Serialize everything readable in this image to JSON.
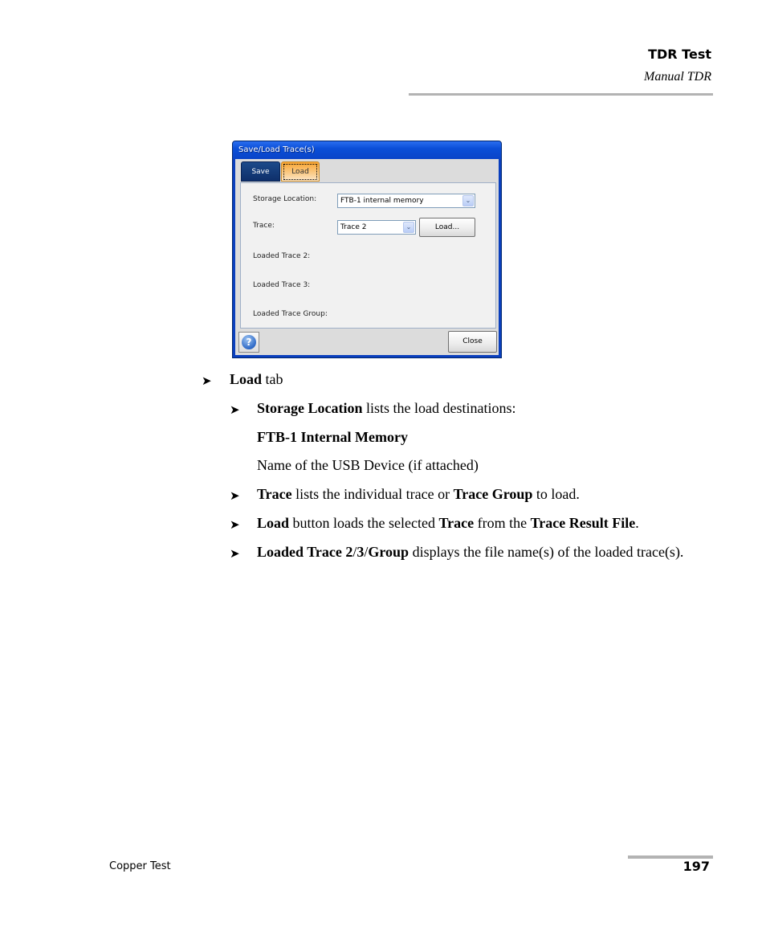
{
  "header": {
    "title": "TDR Test",
    "subtitle": "Manual TDR"
  },
  "dialog": {
    "title": "Save/Load Trace(s)",
    "tabs": [
      {
        "label": "Save",
        "active": false
      },
      {
        "label": "Load",
        "active": true
      }
    ],
    "fields": {
      "storage_location_label": "Storage Location:",
      "storage_location_value": "FTB-1 internal memory",
      "trace_label": "Trace:",
      "trace_value": "Trace 2",
      "load_button": "Load...",
      "loaded_trace2_label": "Loaded Trace 2:",
      "loaded_trace3_label": "Loaded Trace 3:",
      "loaded_trace_group_label": "Loaded Trace Group:"
    },
    "help_icon": "?",
    "close_button": "Close",
    "dropdown_arrow": "⌄"
  },
  "content": {
    "bullet_glyph": "➤",
    "item1": {
      "bold": "Load",
      "text": " tab"
    },
    "item2": {
      "bold": "Storage Location",
      "text": " lists the load destinations:"
    },
    "dest1": "FTB-1 Internal Memory",
    "dest2": "Name of the USB Device (if attached)",
    "item3": {
      "b1": "Trace",
      "t1": " lists the individual trace or ",
      "b2": "Trace Group",
      "t2": " to load."
    },
    "item4": {
      "b1": "Load",
      "t1": " button loads the selected ",
      "b2": "Trace",
      "t2": " from the ",
      "b3": "Trace Result File",
      "t3": "."
    },
    "item5": {
      "b1": "Loaded Trace 2",
      "s1": "/",
      "b2": "3",
      "s2": "/",
      "b3": "Group",
      "t1": " displays the file name(s) of the loaded trace(s)."
    }
  },
  "footer": {
    "section": "Copper Test",
    "page_number": "197"
  }
}
